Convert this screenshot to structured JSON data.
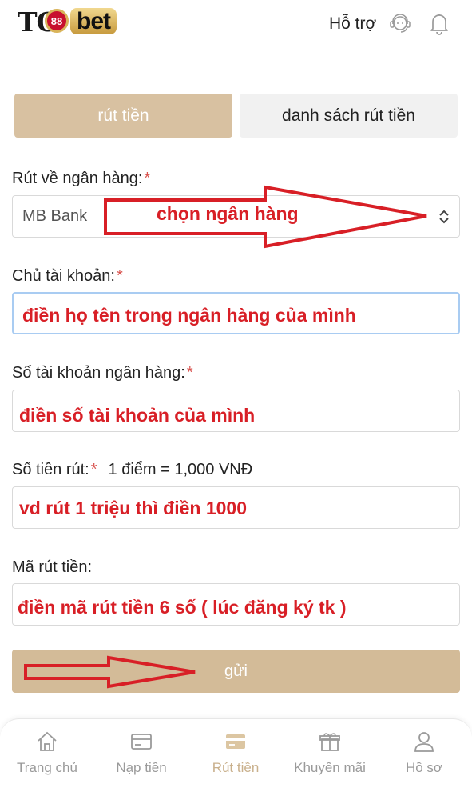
{
  "header": {
    "logo_text": "TO 88 bet",
    "support_label": "Hỗ trợ"
  },
  "tabs": [
    {
      "label": "rút tiền",
      "active": true
    },
    {
      "label": "danh sách rút tiền",
      "active": false
    }
  ],
  "form": {
    "bank": {
      "label": "Rút về ngân hàng:",
      "value": "MB Bank",
      "note": "chọn ngân hàng"
    },
    "holder": {
      "label": "Chủ tài khoản:",
      "note": "điền họ tên trong ngân hàng của mình"
    },
    "account_number": {
      "label": "Số tài khoản ngân hàng:",
      "note": "điền số tài khoản của mình"
    },
    "amount": {
      "label": "Số tiền rút:",
      "rate": "1 điểm = 1,000 VNĐ",
      "note": "vd rút 1 triệu thì điền 1000"
    },
    "pin": {
      "label": "Mã rút tiền:",
      "note": "điền mã rút tiền 6 số ( lúc đăng ký tk )"
    },
    "required_mark": "*",
    "submit_label": "gửi"
  },
  "bottom_nav": [
    {
      "label": "Trang chủ",
      "icon": "home-icon",
      "active": false
    },
    {
      "label": "Nạp tiền",
      "icon": "card-icon",
      "active": false
    },
    {
      "label": "Rút tiền",
      "icon": "withdraw-card-icon",
      "active": true
    },
    {
      "label": "Khuyến mãi",
      "icon": "gift-icon",
      "active": false
    },
    {
      "label": "Hồ sơ",
      "icon": "user-icon",
      "active": false
    }
  ],
  "colors": {
    "accent": "#d3bb98",
    "annotation_red": "#d81f26",
    "required_red": "#d9534f"
  }
}
